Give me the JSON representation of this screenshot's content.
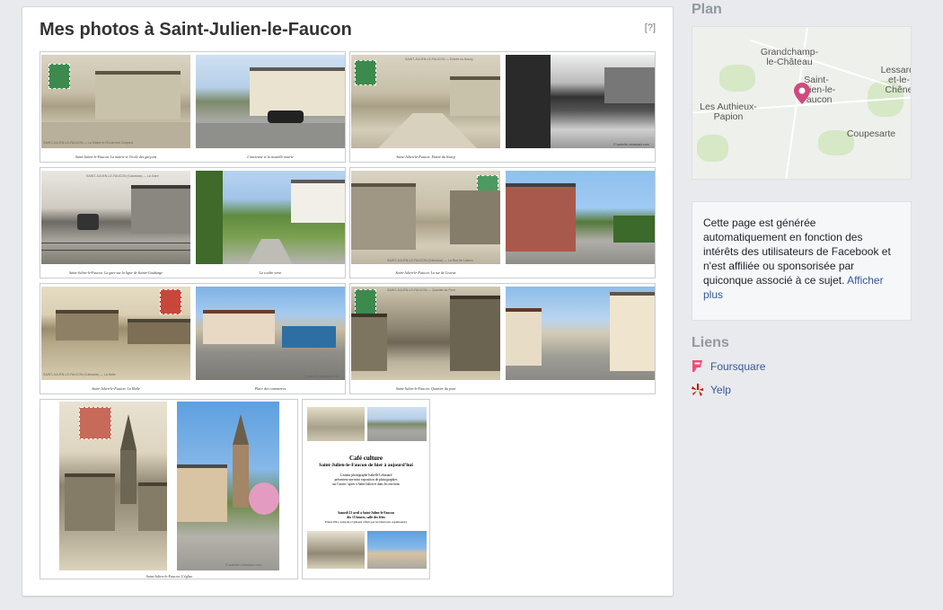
{
  "photos_card": {
    "title": "Mes photos à Saint-Julien-le-Faucon",
    "help": "[?]"
  },
  "photos": [
    {
      "name": "photo-mairie-ecole",
      "caption": "Saint-Julien-le-Faucon. La mairie et l'école des garçons",
      "caption2": "L'ancienne et la nouvelle mairie"
    },
    {
      "name": "photo-entree-bourg",
      "caption": "Saint-Julien-le-Faucon. Entrée du bourg"
    },
    {
      "name": "photo-gare",
      "caption": "Saint-Julien-le-Faucon. La gare sur la ligne de Sainte-Gauburge",
      "caption2": "La coulée verte"
    },
    {
      "name": "photo-rue-lisieux",
      "caption": "Saint-Julien-le-Faucon. La rue de Lisieux"
    },
    {
      "name": "photo-halle",
      "caption": "Saint-Julien-le-Faucon. La Halle",
      "caption2": "Place des commerces"
    },
    {
      "name": "photo-quartier-pont",
      "caption": "Saint-Julien-le-Faucon. Quartier du pont"
    },
    {
      "name": "photo-eglise",
      "caption": "Saint-Julien-le-Faucon. L'église"
    },
    {
      "name": "photo-flyer",
      "caption": "Café culture"
    }
  ],
  "postcard_texts": {
    "p1": "SAINT-JULIEN-LE-FAUCON — La Mairie et l'Ecole des Garçons",
    "p2": "SAINT-JULIEN-LE-FAUCON — Entrée du Bourg",
    "p3": "SAINT-JULIEN-LE-FAUCON (Calvados) — La Gare",
    "p4": "SAINT-JULIEN-LE-FAUCON (Calvados) — La Rue de Lisieux",
    "p5": "SAINT-JULIEN-LE-FAUCON (Calvados) — La Halle",
    "p6": "SAINT-JULIEN-LE-FAUCON — Quartier du Pont"
  },
  "credit": "© Isabelle.Lebastard.com",
  "flyer": {
    "title1": "Café culture",
    "title2": "Saint-Julien-le-Faucon de hier à aujourd'hui",
    "line1": "L'auteur photographe Isabelle Lebastard",
    "line2": "présentera une mini exposition de photographies",
    "line3": "sur l'avant / après à Saint-Julien et dans les environs",
    "line4": "Samedi 23 avril à Saint-Julien-le-Faucon",
    "line5": "dès 15 heures, salle des fêtes",
    "line6": "Entrée libre, boissons et gâteaux offerts par les bénévoles organisateurs"
  },
  "sidebar": {
    "plan_title": "Plan",
    "map_labels": {
      "grandchamp": "Grandchamp-\nle-Château",
      "saint_julien": "Saint-\nJulien-le-\nFaucon",
      "lessard": "Lessard-\net-le-\nChêne",
      "authieux": "Les Authieux-\nPapion",
      "coupesarte": "Coupesarte"
    },
    "info_text": "Cette page est générée automatiquement en fonction des intérêts des utilisateurs de Facebook et n'est affiliée ou sponsorisée par quiconque associé à ce sujet.",
    "info_more": "Afficher plus",
    "links_title": "Liens",
    "links": [
      {
        "label": "Foursquare",
        "icon": "foursquare-icon",
        "color": "#f94877"
      },
      {
        "label": "Yelp",
        "icon": "yelp-icon",
        "color": "#c41200"
      }
    ]
  },
  "colors": {
    "link": "#365899",
    "section_header": "#9197a3",
    "map_pin": "#d04a7c"
  }
}
